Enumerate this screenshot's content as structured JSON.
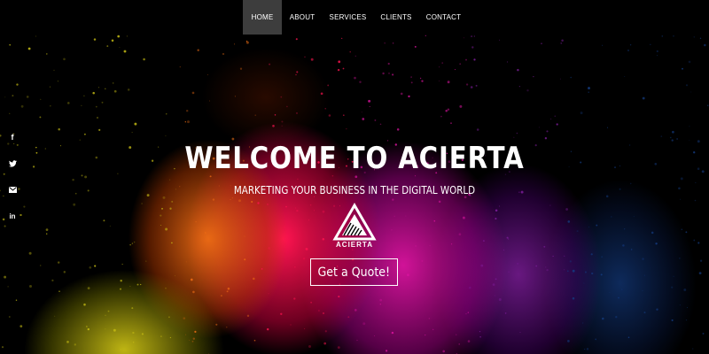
{
  "nav": {
    "items": [
      {
        "label": "HOME",
        "active": true
      },
      {
        "label": "ABOUT",
        "active": false
      },
      {
        "label": "SERVICES",
        "active": false
      },
      {
        "label": "CLIENTS",
        "active": false
      },
      {
        "label": "CONTACT",
        "active": false
      }
    ]
  },
  "social": {
    "icons": [
      "facebook-icon",
      "twitter-icon",
      "mail-icon",
      "linkedin-icon"
    ],
    "glyphs": [
      "f",
      "t",
      "✉",
      "in"
    ]
  },
  "hero": {
    "title": "WELCOME TO ACIERTA",
    "subtitle": "MARKETING YOUR BUSINESS IN THE DIGITAL WORLD",
    "logo_text": "ACIERTA",
    "cta_label": "Get a Quote!"
  },
  "colors": {
    "background": "#000000",
    "nav_active": "#3d3d3d",
    "text": "#ffffff",
    "powder": [
      "#c8be14",
      "#f06e14",
      "#ff1450",
      "#dc14a0",
      "#821ea0",
      "#143c82"
    ]
  }
}
